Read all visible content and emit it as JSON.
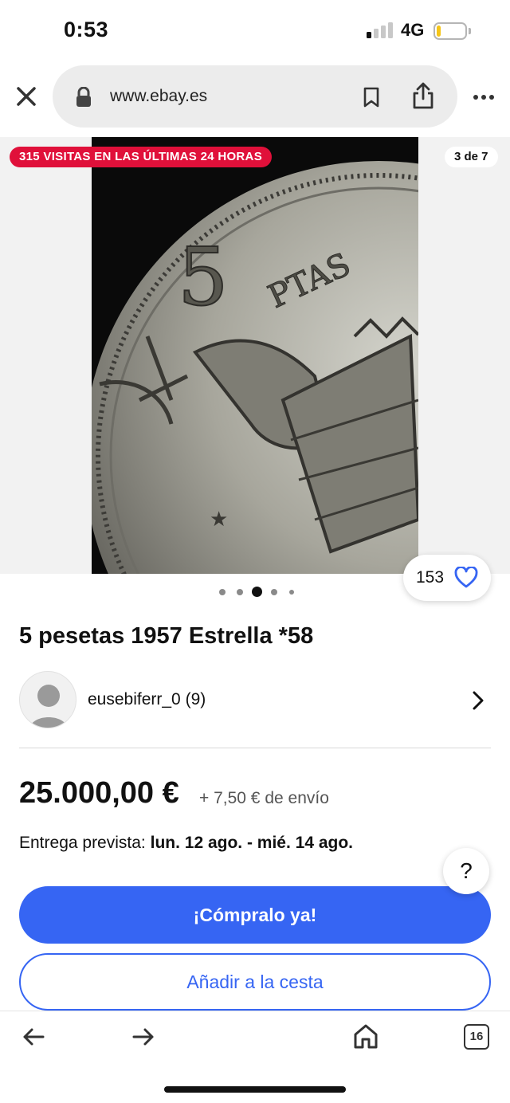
{
  "status_bar": {
    "time": "0:53",
    "network": "4G",
    "signal_bars_on": 1,
    "signal_bars_total": 4,
    "battery_level": 0.15
  },
  "browser": {
    "url": "www.ebay.es"
  },
  "gallery": {
    "visits_badge": "315 VISITAS EN LAS ÚLTIMAS 24 HORAS",
    "counter": "3 de 7",
    "current_index": 3,
    "total_images": 7,
    "coin_text": {
      "denomination": "5",
      "unit": "PTAS"
    }
  },
  "watchers": {
    "count": "153"
  },
  "listing": {
    "title": "5 pesetas 1957 Estrella *58",
    "seller": "eusebiferr_0 (9)",
    "price": "25.000,00 €",
    "shipping": "+ 7,50 € de envío",
    "delivery_label": "Entrega prevista:",
    "delivery_dates": "lun. 12 ago. - mié. 14 ago."
  },
  "actions": {
    "help": "?",
    "buy_now": "¡Cómpralo ya!",
    "add_to_cart": "Añadir a la cesta"
  },
  "toolbar": {
    "tabs_count": "16"
  },
  "colors": {
    "accent": "#3665f3",
    "badge": "#e0103a",
    "battery": "#f5c518"
  }
}
